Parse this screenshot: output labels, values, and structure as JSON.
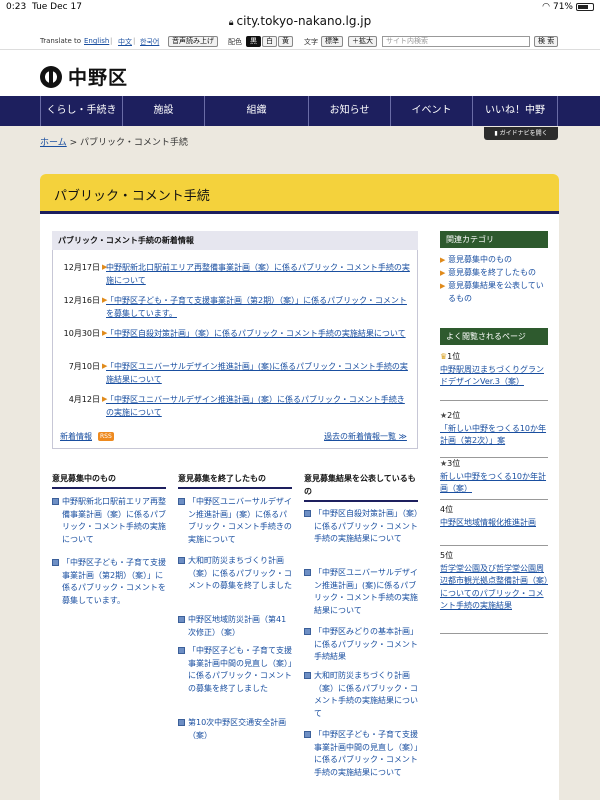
{
  "status": {
    "time": "0:23",
    "date": "Tue Dec 17",
    "battery": "71%",
    "battery_level": 0.71
  },
  "url": "city.tokyo-nakano.lg.jp",
  "util": {
    "translate": "Translate to",
    "english": "English",
    "chinese": "中文",
    "korean": "한국어",
    "read_aloud": "音声読み上げ",
    "color_label": "配色",
    "color_black": "黒",
    "color_white": "白",
    "color_yellow": "黄",
    "text_label": "文字",
    "text_standard": "標準",
    "text_larger": "＋拡大",
    "search_placeholder": "サイト内検索",
    "search_button": "検 索"
  },
  "logo_text": "中野区",
  "nav": [
    "くらし・手続き",
    "施設",
    "組織",
    "お知らせ",
    "イベント",
    "いいね！中野"
  ],
  "guide": "ガイドナビを開く",
  "breadcrumb": {
    "home": "ホーム",
    "sep": ">",
    "current": "パブリック・コメント手続"
  },
  "page_title": "パブリック・コメント手続",
  "newinfo": {
    "heading": "パブリック・コメント手続の新着情報",
    "items": [
      {
        "date": "12月17日",
        "text": "中野駅新北口駅前エリア再整備事業計画（案）に係るパブリック・コメント手続の実施について"
      },
      {
        "date": "12月16日",
        "text": "「中野区子ども・子育て支援事業計画（第2期）（案）」に係るパブリック・コメントを募集しています。"
      },
      {
        "date": "10月30日",
        "text": "「中野区自殺対策計画」（案）に係るパブリック・コメント手続の実施結果について"
      },
      {
        "date": "7月10日",
        "text": "「中野区ユニバーサルデザイン推進計画」(案)に係るパブリック・コメント手続の実施結果について"
      },
      {
        "date": "4月12日",
        "text": "「中野区ユニバーサルデザイン推進計画」(案）に係るパブリック・コメント手続きの実施について"
      }
    ],
    "rss_label": "新着情報",
    "rss_badge": "RSS",
    "archive": "過去の新着情報一覧 ≫"
  },
  "columns": [
    {
      "heading": "意見募集中のもの",
      "items": [
        "中野駅新北口駅前エリア再整備事業計画（案）に係るパブリック・コメント手続の実施について",
        "「中野区子ども・子育て支援事業計画（第2期）（案）」に係るパブリック・コメントを募集しています。"
      ]
    },
    {
      "heading": "意見募集を終了したもの",
      "items": [
        "「中野区ユニバーサルデザイン推進計画」(案）に係るパブリック・コメント手続きの実施について",
        "大和町防災まちづくり計画（案）に係るパブリック・コメントの募集を終了しました",
        "中野区地域防災計画（第41次修正）（案）",
        "「中野区子ども・子育て支援事業計画中間の見直し（案）」に係るパブリック・コメントの募集を終了しました",
        "第10次中野区交通安全計画（案）"
      ]
    },
    {
      "heading": "意見募集結果を公表しているもの",
      "items": [
        "「中野区自殺対策計画」（案）に係るパブリック・コメント手続の実施結果について",
        "「中野区ユニバーサルデザイン推進計画」(案)に係るパブリック・コメント手続の実施結果について",
        "「中野区みどりの基本計画」に係るパブリック・コメント手続結果",
        "大和町防災まちづくり計画（案）に係るパブリック・コメント手続の実施結果について",
        "「中野区子ども・子育て支援事業計画中間の見直し（案）」に係るパブリック・コメント手続の実施結果について"
      ]
    }
  ],
  "sidebar": {
    "cat_heading": "関連カテゴリ",
    "categories": [
      "意見募集中のもの",
      "意見募集を終了したもの",
      "意見募集結果を公表しているもの"
    ],
    "rank_heading": "よく閲覧されるページ",
    "ranking": [
      {
        "rank": "1位",
        "text": "中野駅周辺まちづくりグランドデザインVer.3（案）"
      },
      {
        "rank": "2位",
        "text": "「新しい中野をつくる10か年計画（第2次）」案"
      },
      {
        "rank": "3位",
        "text": "新しい中野をつくる10か年計画（案）"
      },
      {
        "rank": "4位",
        "text": "中野区地域情報化推進計画"
      },
      {
        "rank": "5位",
        "text": "哲学堂公園及び哲学堂公園周辺都市観光拠点整備計画（案）についてのパブリック・コメント手続の実施結果"
      }
    ]
  }
}
